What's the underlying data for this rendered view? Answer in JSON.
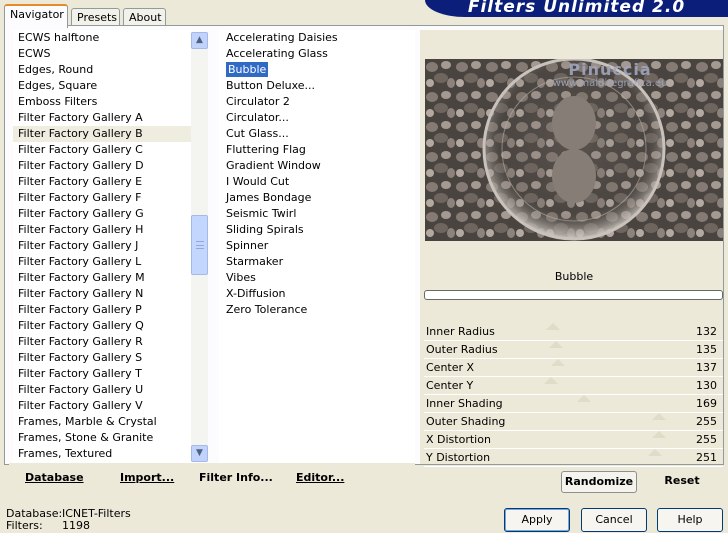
{
  "banner_title": "Filters Unlimited 2.0",
  "tabs": [
    {
      "label": "Navigator",
      "active": true
    },
    {
      "label": "Presets",
      "active": false
    },
    {
      "label": "About",
      "active": false
    }
  ],
  "categories": {
    "items": [
      "ECWS halftone",
      "ECWS",
      "Edges, Round",
      "Edges, Square",
      "Emboss Filters",
      "Filter Factory Gallery A",
      "Filter Factory Gallery B",
      "Filter Factory Gallery C",
      "Filter Factory Gallery D",
      "Filter Factory Gallery E",
      "Filter Factory Gallery F",
      "Filter Factory Gallery G",
      "Filter Factory Gallery H",
      "Filter Factory Gallery J",
      "Filter Factory Gallery L",
      "Filter Factory Gallery M",
      "Filter Factory Gallery N",
      "Filter Factory Gallery P",
      "Filter Factory Gallery Q",
      "Filter Factory Gallery R",
      "Filter Factory Gallery S",
      "Filter Factory Gallery T",
      "Filter Factory Gallery U",
      "Filter Factory Gallery V",
      "Frames, Marble & Crystal",
      "Frames, Stone & Granite",
      "Frames, Textured"
    ],
    "selected": "Filter Factory Gallery B"
  },
  "filters": {
    "items": [
      "Accelerating Daisies",
      "Accelerating Glass",
      "Bubble",
      "Button Deluxe...",
      "Circulator 2",
      "Circulator...",
      "Cut Glass...",
      "Fluttering Flag",
      "Gradient Window",
      "I Would Cut",
      "James Bondage",
      "Seismic Twirl",
      "Sliding Spirals",
      "Spinner",
      "Starmaker",
      "Vibes",
      "X-Diffusion",
      "Zero Tolerance"
    ],
    "selected": "Bubble"
  },
  "links": {
    "database": "Database",
    "import": "Import...",
    "filter_info": "Filter Info...",
    "editor": "Editor..."
  },
  "preview": {
    "filter_name": "Bubble",
    "progress_fraction": 0
  },
  "watermark": {
    "line1": "Pinuccia",
    "line2": "www.maidiregrafica.eu"
  },
  "params": [
    {
      "label": "Inner Radius",
      "value": "132",
      "level": 0.52
    },
    {
      "label": "Outer Radius",
      "value": "135",
      "level": 0.53
    },
    {
      "label": "Center X",
      "value": "137",
      "level": 0.54
    },
    {
      "label": "Center Y",
      "value": "130",
      "level": 0.51
    },
    {
      "label": "Inner Shading",
      "value": "169",
      "level": 0.66
    },
    {
      "label": "Outer Shading",
      "value": "255",
      "level": 1.0
    },
    {
      "label": "X Distortion",
      "value": "255",
      "level": 1.0
    },
    {
      "label": "Y Distortion",
      "value": "251",
      "level": 0.98
    }
  ],
  "buttons": {
    "randomize": "Randomize",
    "reset": "Reset",
    "apply": "Apply",
    "cancel": "Cancel",
    "help": "Help"
  },
  "status": {
    "database_label": "Database:",
    "database_value": "ICNET-Filters",
    "filters_label": "Filters:",
    "filters_value": "1198"
  },
  "icons": {
    "scroll_up": "chevron-up-icon",
    "scroll_down": "chevron-down-icon"
  }
}
